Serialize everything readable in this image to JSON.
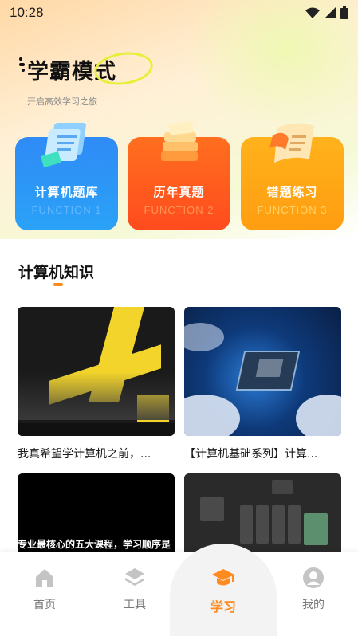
{
  "status_bar": {
    "time": "10:28"
  },
  "brand": {
    "title": "学霸模式",
    "subtitle": "开启高效学习之旅"
  },
  "function_cards": [
    {
      "label": "计算机题库",
      "sub": "FUNCTION 1",
      "color": "#2f8bf6"
    },
    {
      "label": "历年真题",
      "sub": "FUNCTION 2",
      "color": "#ff5a1f"
    },
    {
      "label": "错题练习",
      "sub": "FUNCTION 3",
      "color": "#ffa816"
    }
  ],
  "section": {
    "title": "计算机知识",
    "accent": "#ff8a1e"
  },
  "videos": [
    {
      "caption": "我真希望学计算机之前，...",
      "thumb_label": ""
    },
    {
      "caption": "【计算机基础系列】计算...",
      "thumb_label": ""
    },
    {
      "caption": "",
      "thumb_label": "专业最核心的五大课程，学习顺序是"
    },
    {
      "caption": "",
      "thumb_label": ""
    }
  ],
  "tabbar": {
    "items": [
      {
        "label": "首页",
        "icon": "home-icon",
        "active": false
      },
      {
        "label": "工具",
        "icon": "layers-icon",
        "active": false
      },
      {
        "label": "学习",
        "icon": "graduation-cap-icon",
        "active": true
      },
      {
        "label": "我的",
        "icon": "user-icon",
        "active": false
      }
    ],
    "active_color": "#ff8a1e",
    "inactive_color": "#c4c4c4"
  }
}
